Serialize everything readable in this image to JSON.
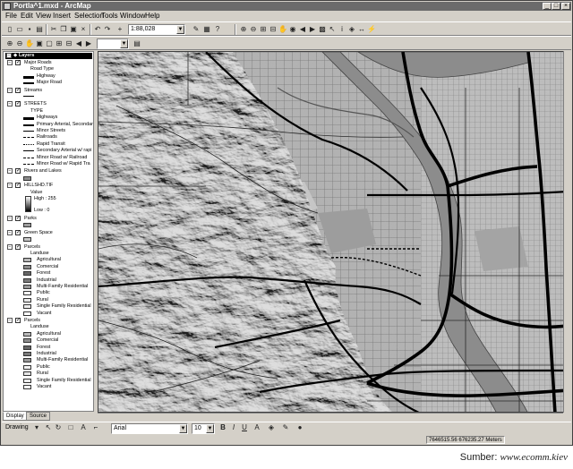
{
  "window": {
    "title": "Portla^1.mxd - ArcMap",
    "app_icon": "globe-icon"
  },
  "menu": [
    "File",
    "Edit",
    "View",
    "Insert",
    "Selection",
    "Tools",
    "Window",
    "Help"
  ],
  "toolbar": {
    "scale_value": "1:88,028"
  },
  "toc": {
    "root": "Layers",
    "layers": [
      {
        "name": "Major Roads",
        "field": "Road Type",
        "classes": [
          "Highway",
          "Major Road"
        ]
      },
      {
        "name": "Streams"
      },
      {
        "name": "STREETS",
        "field": "TYPE",
        "classes": [
          "Highways",
          "Primary Arterial, Secondar",
          "Minor Streets",
          "Railroads",
          "Rapid Transit",
          "Secondary Arterial w/ rapi",
          "Minor Road w/ Railroad",
          "Minor Road w/ Rapid Tra"
        ]
      },
      {
        "name": "Rivers and Lakes"
      },
      {
        "name": "HILLSHD.TIF",
        "field": "Value",
        "high": "High : 255",
        "low": "Low : 0"
      },
      {
        "name": "Parks"
      },
      {
        "name": "Green Space"
      },
      {
        "name": "Parcels",
        "field": "Landuse",
        "classes": [
          "Agricultural",
          "Comercial",
          "Forest",
          "Industrial",
          "Multi-Family Residential",
          "Public",
          "Rural",
          "Single Family Residential",
          "Vacant"
        ]
      },
      {
        "name": "Parcels",
        "field": "Landuse",
        "classes": [
          "Agricultural",
          "Comercial",
          "Forest",
          "Industrial",
          "Multi-Family Residential",
          "Public",
          "Rural",
          "Single Family Residential",
          "Vacant"
        ]
      }
    ],
    "tabs": [
      "Display",
      "Source"
    ]
  },
  "drawing": {
    "label": "Drawing",
    "font": "Arial",
    "size": "10",
    "bold": "B",
    "italic": "I",
    "underline": "U",
    "font_color": "A"
  },
  "status": {
    "coords": "7646515.56  676235.27 Meters"
  },
  "caption": {
    "prefix": "Sumber: ",
    "source": "www.ecomm.kiev"
  }
}
